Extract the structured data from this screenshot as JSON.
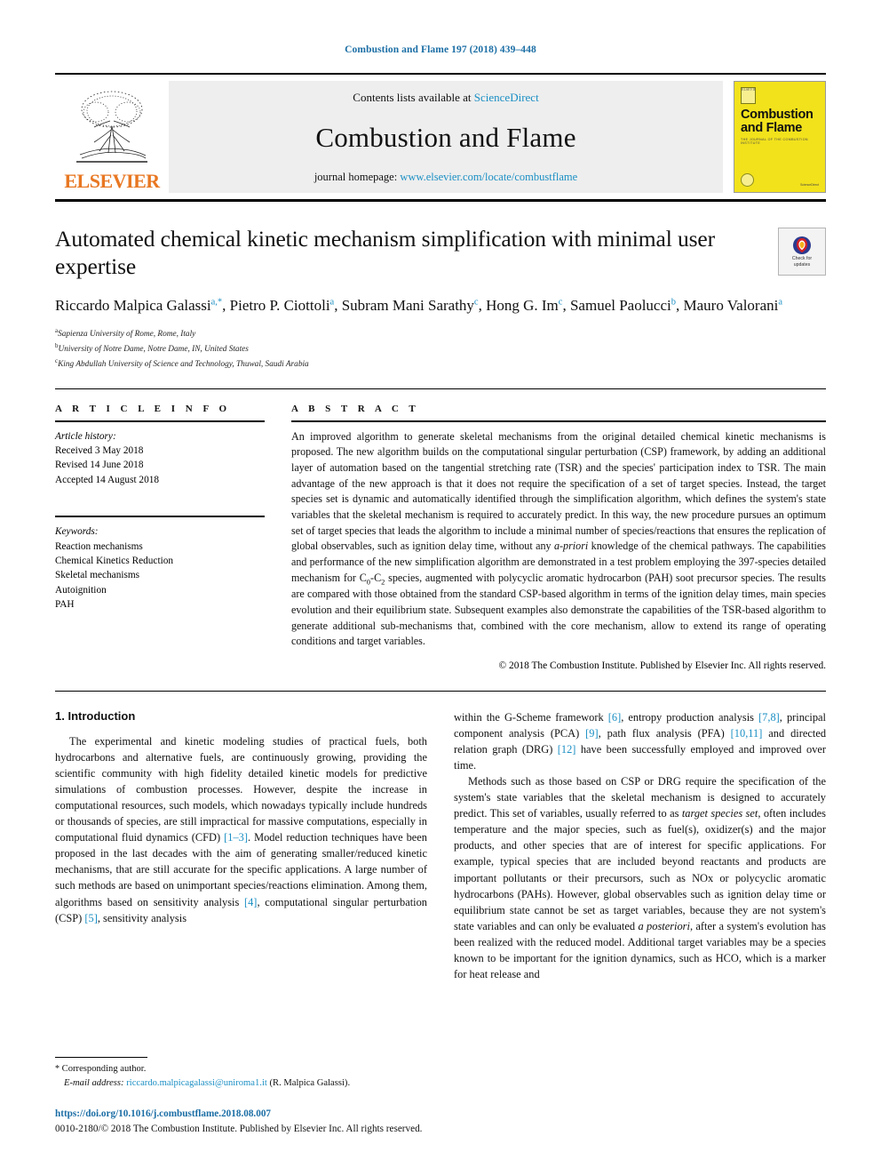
{
  "running_head": "Combustion and Flame 197 (2018) 439–448",
  "masthead": {
    "publisher_name": "ELSEVIER",
    "contents_prefix": "Contents lists available at ",
    "contents_link": "ScienceDirect",
    "journal_title": "Combustion and Flame",
    "homepage_prefix": "journal homepage: ",
    "homepage_url": "www.elsevier.com/locate/combustflame",
    "cover": {
      "title_line1": "Combustion",
      "title_line2": "and Flame",
      "subtitle": "THE JOURNAL OF THE COMBUSTION INSTITUTE",
      "publisher_mark": "ScienceDirect",
      "publisher_mark_top": "ELSEVIER"
    },
    "accent_link_color": "#1b8fc4",
    "elsevier_orange": "#e87722",
    "cover_yellow": "#f2e21c"
  },
  "article": {
    "title": "Automated chemical kinetic mechanism simplification with minimal user expertise",
    "crossmark_label_line1": "Check for",
    "crossmark_label_line2": "updates",
    "authors_html": "Riccardo Malpica Galassi<sup>a,*</sup>, Pietro P. Ciottoli<sup>a</sup>, Subram Mani Sarathy<sup>c</sup>, Hong G. Im<sup>c</sup>, Samuel Paolucci<sup>b</sup>, Mauro Valorani<sup>a</sup>",
    "affiliations": [
      {
        "marker": "a",
        "text": "Sapienza University of Rome, Rome, Italy"
      },
      {
        "marker": "b",
        "text": "University of Notre Dame, Notre Dame, IN, United States"
      },
      {
        "marker": "c",
        "text": "King Abdullah University of Science and Technology, Thuwal, Saudi Arabia"
      }
    ]
  },
  "article_info": {
    "heading": "A R T I C L E   I N F O",
    "history_label": "Article history:",
    "history": [
      "Received 3 May 2018",
      "Revised 14 June 2018",
      "Accepted 14 August 2018"
    ],
    "keywords_label": "Keywords:",
    "keywords": [
      "Reaction mechanisms",
      "Chemical Kinetics Reduction",
      "Skeletal mechanisms",
      "Autoignition",
      "PAH"
    ]
  },
  "abstract": {
    "heading": "A B S T R A C T",
    "body_html": "An improved algorithm to generate skeletal mechanisms from the original detailed chemical kinetic mechanisms is proposed. The new algorithm builds on the computational singular perturbation (CSP) framework, by adding an additional layer of automation based on the tangential stretching rate (TSR) and the species' participation index to TSR. The main advantage of the new approach is that it does not require the specification of a set of target species. Instead, the target species set is dynamic and automatically identified through the simplification algorithm, which defines the system's state variables that the skeletal mechanism is required to accurately predict. In this way, the new procedure pursues an optimum set of target species that leads the algorithm to include a minimal number of species/reactions that ensures the replication of global observables, such as ignition delay time, without any <i>a-priori</i> knowledge of the chemical pathways. The capabilities and performance of the new simplification algorithm are demonstrated in a test problem employing the 397-species detailed mechanism for C<sub>0</sub>-C<sub>2</sub> species, augmented with polycyclic aromatic hydrocarbon (PAH) soot precursor species. The results are compared with those obtained from the standard CSP-based algorithm in terms of the ignition delay times, main species evolution and their equilibrium state. Subsequent examples also demonstrate the capabilities of the TSR-based algorithm to generate additional sub-mechanisms that, combined with the core mechanism, allow to extend its range of operating conditions and target variables.",
    "copyright": "© 2018 The Combustion Institute. Published by Elsevier Inc. All rights reserved."
  },
  "body": {
    "section_title": "1. Introduction",
    "left_paragraphs_html": [
      "The experimental and kinetic modeling studies of practical fuels, both hydrocarbons and alternative fuels, are continuously growing, providing the scientific community with high fidelity detailed kinetic models for predictive simulations of combustion processes. However, despite the increase in computational resources, such models, which nowadays typically include hundreds or thousands of species, are still impractical for massive computations, especially in computational fluid dynamics (CFD) <span class=\"ref\">[1–3]</span>. Model reduction techniques have been proposed in the last decades with the aim of generating smaller/reduced kinetic mechanisms, that are still accurate for the specific applications. A large number of such methods are based on unimportant species/reactions elimination. Among them, algorithms based on sensitivity analysis <span class=\"ref\">[4]</span>, computational singular perturbation (CSP) <span class=\"ref\">[5]</span>, sensitivity analysis"
    ],
    "right_paragraphs_html": [
      "within the G-Scheme framework <span class=\"ref\">[6]</span>, entropy production analysis <span class=\"ref\">[7,8]</span>, principal component analysis (PCA) <span class=\"ref\">[9]</span>, path flux analysis (PFA) <span class=\"ref\">[10,11]</span> and directed relation graph (DRG) <span class=\"ref\">[12]</span> have been successfully employed and improved over time.",
      "Methods such as those based on CSP or DRG require the specification of the system's state variables that the skeletal mechanism is designed to accurately predict. This set of variables, usually referred to as <i>target species set</i>, often includes temperature and the major species, such as fuel(s), oxidizer(s) and the major products, and other species that are of interest for specific applications. For example, typical species that are included beyond reactants and products are important pollutants or their precursors, such as NOx or polycyclic aromatic hydrocarbons (PAHs). However, global observables such as ignition delay time or equilibrium state cannot be set as target variables, because they are not system's state variables and can only be evaluated <i>a posteriori</i>, after a system's evolution has been realized with the reduced model. Additional target variables may be a species known to be important for the ignition dynamics, such as HCO, which is a marker for heat release and"
    ]
  },
  "footnote": {
    "corresponding_marker": "*",
    "corresponding_text": "Corresponding author.",
    "email_label": "E-mail address:",
    "email": "riccardo.malpicagalassi@uniroma1.it",
    "email_owner": "(R. Malpica Galassi)."
  },
  "page_footer": {
    "doi": "https://doi.org/10.1016/j.combustflame.2018.08.007",
    "issn_line": "0010-2180/© 2018 The Combustion Institute. Published by Elsevier Inc. All rights reserved."
  }
}
